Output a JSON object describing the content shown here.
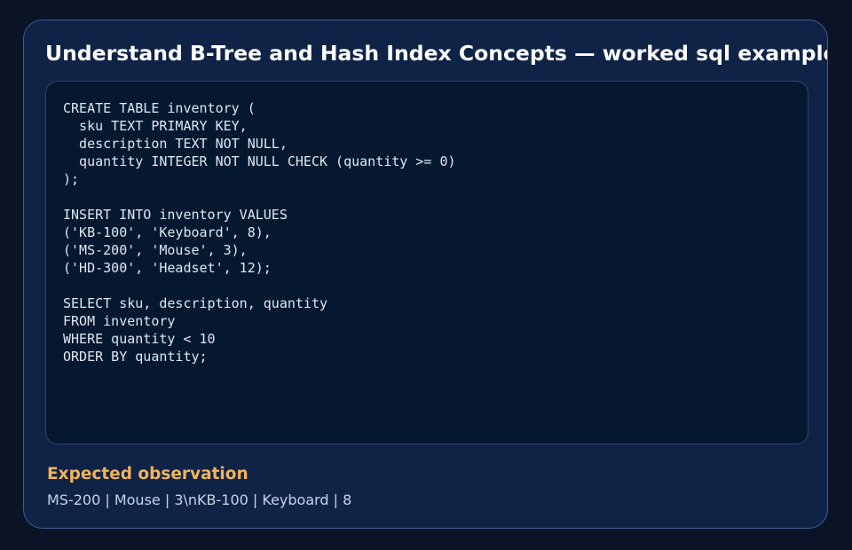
{
  "card": {
    "title": "Understand B-Tree and Hash Index Concepts — worked sql example",
    "code": "CREATE TABLE inventory (\n  sku TEXT PRIMARY KEY,\n  description TEXT NOT NULL,\n  quantity INTEGER NOT NULL CHECK (quantity >= 0)\n);\n\nINSERT INTO inventory VALUES\n('KB-100', 'Keyboard', 8),\n('MS-200', 'Mouse', 3),\n('HD-300', 'Headset', 12);\n\nSELECT sku, description, quantity\nFROM inventory\nWHERE quantity < 10\nORDER BY quantity;",
    "observation_heading": "Expected observation",
    "observation_text": "MS-200 | Mouse | 3\\nKB-100 | Keyboard | 8"
  },
  "colors": {
    "background": "#0a1426",
    "card": "#0f2347",
    "card_border": "#3f5f92",
    "code_panel": "#06182f",
    "title": "#ffffff",
    "accent": "#f2b25a",
    "body_text": "#c5d4e8"
  }
}
